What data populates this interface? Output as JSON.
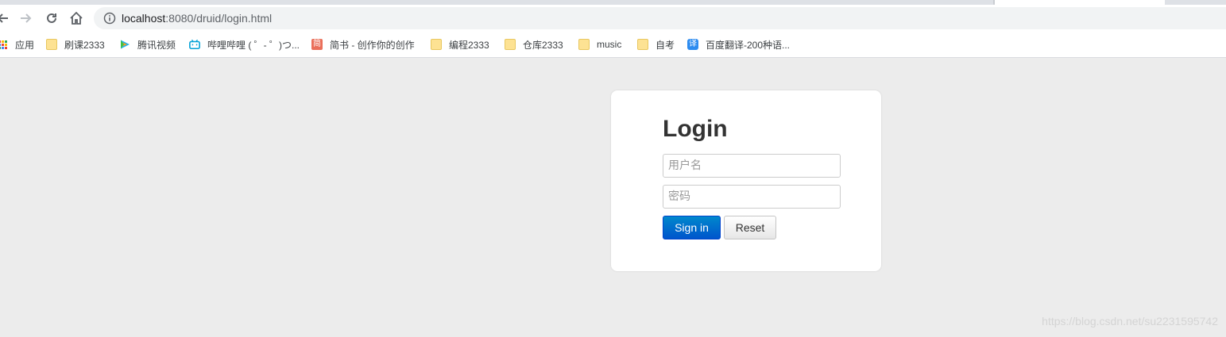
{
  "browser": {
    "url_host": "localhost",
    "url_rest": ":8080/druid/login.html"
  },
  "bookmarks": [
    {
      "label": "应用",
      "icon": "apps-grid-icon"
    },
    {
      "label": "刷课2333",
      "icon": "folder-icon"
    },
    {
      "label": "腾讯视频",
      "icon": "tencent-video-icon"
    },
    {
      "label": "哔哩哔哩 ( ゜- ゜)つ...",
      "icon": "bilibili-icon"
    },
    {
      "label": "简书 - 创作你的创作",
      "icon": "jianshu-icon"
    },
    {
      "label": "编程2333",
      "icon": "folder-icon"
    },
    {
      "label": "仓库2333",
      "icon": "folder-icon"
    },
    {
      "label": "music",
      "icon": "folder-icon"
    },
    {
      "label": "自考",
      "icon": "folder-icon"
    },
    {
      "label": "百度翻译-200种语...",
      "icon": "baidu-translate-icon"
    }
  ],
  "login": {
    "title": "Login",
    "username_placeholder": "用户名",
    "password_placeholder": "密码",
    "signin_label": "Sign in",
    "reset_label": "Reset"
  },
  "watermark": "https://blog.csdn.net/su2231595742",
  "colors": {
    "page_bg": "#ececec",
    "primary_button": "#0066cc",
    "card_bg": "#ffffff"
  }
}
